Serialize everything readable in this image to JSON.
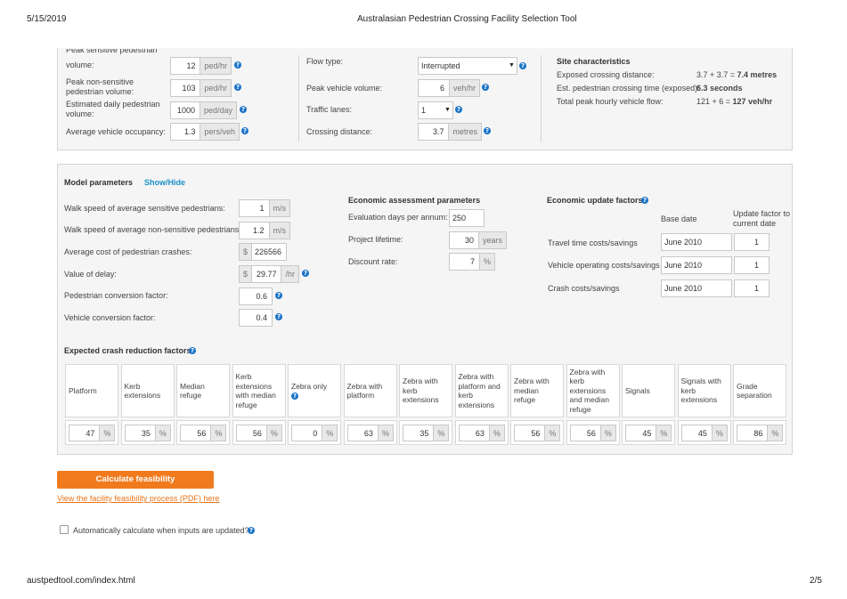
{
  "print": {
    "date": "5/15/2019",
    "title": "Australasian Pedestrian Crossing Facility Selection Tool",
    "url": "austpedtool.com/index.html",
    "page": "2/5"
  },
  "inputs_top": {
    "cut_label": "Peak sensitive pedestrian",
    "rows_left": [
      {
        "label": "volume:",
        "value": "12",
        "unit": "ped/hr"
      },
      {
        "label": "Peak non-sensitive pedestrian volume:",
        "value": "103",
        "unit": "ped/hr"
      },
      {
        "label": "Estimated daily pedestrian volume:",
        "value": "1000",
        "unit": "ped/day"
      },
      {
        "label": "Average vehicle occupancy:",
        "value": "1.3",
        "unit": "pers/veh"
      }
    ],
    "flow_type": {
      "label": "Flow type:",
      "value": "Interrupted"
    },
    "peak_vehicle": {
      "label": "Peak vehicle volume:",
      "value": "6",
      "unit": "veh/hr"
    },
    "traffic_lanes": {
      "label": "Traffic lanes:",
      "value": "1"
    },
    "crossing_distance": {
      "label": "Crossing distance:",
      "value": "3.7",
      "unit": "metres"
    }
  },
  "site": {
    "title": "Site characteristics",
    "rows": [
      {
        "label": "Exposed crossing distance:",
        "calc": "3.7 + 3.7 = ",
        "result": "7.4 metres"
      },
      {
        "label": "Est. pedestrian crossing time (exposed):",
        "calc": "",
        "result": "6.3 seconds"
      },
      {
        "label": "Total peak hourly vehicle flow:",
        "calc": "121 + 6 = ",
        "result": "127 veh/hr"
      }
    ]
  },
  "model": {
    "title": "Model parameters",
    "toggle": "Show/Hide",
    "rows": [
      {
        "label": "Walk speed of average sensitive pedestrians:",
        "value": "1",
        "unit": "m/s",
        "prefix": ""
      },
      {
        "label": "Walk speed of average non-sensitive pedestrians:",
        "value": "1.2",
        "unit": "m/s",
        "prefix": ""
      },
      {
        "label": "Average cost of pedestrian crashes:",
        "value": "226566",
        "unit": "",
        "prefix": "$"
      },
      {
        "label": "Value of delay:",
        "value": "29.77",
        "unit": "/hr",
        "prefix": "$"
      },
      {
        "label": "Pedestrian conversion factor:",
        "value": "0.6",
        "unit": "",
        "prefix": ""
      },
      {
        "label": "Vehicle conversion factor:",
        "value": "0.4",
        "unit": "",
        "prefix": ""
      }
    ]
  },
  "economic": {
    "title": "Economic assessment parameters",
    "rows": [
      {
        "label": "Evaluation days per annum:",
        "value": "250",
        "unit": ""
      },
      {
        "label": "Project lifetime:",
        "value": "30",
        "unit": "years"
      },
      {
        "label": "Discount rate:",
        "value": "7",
        "unit": "%"
      }
    ]
  },
  "update": {
    "title": "Economic update factors",
    "col_base": "Base date",
    "col_factor": "Update factor to current date",
    "rows": [
      {
        "label": "Travel time costs/savings",
        "date": "June  2010",
        "factor": "1"
      },
      {
        "label": "Vehicle operating costs/savings",
        "date": "June  2010",
        "factor": "1"
      },
      {
        "label": "Crash costs/savings",
        "date": "June  2010",
        "factor": "1"
      }
    ]
  },
  "crash": {
    "title": "Expected crash reduction factors",
    "columns": [
      {
        "label": "Platform",
        "value": "47"
      },
      {
        "label": "Kerb extensions",
        "value": "35"
      },
      {
        "label": "Median refuge",
        "value": "56"
      },
      {
        "label": "Kerb extensions with median refuge",
        "value": "56"
      },
      {
        "label": "Zebra only",
        "value": "0"
      },
      {
        "label": "Zebra with platform",
        "value": "63"
      },
      {
        "label": "Zebra with kerb extensions",
        "value": "35"
      },
      {
        "label": "Zebra with platform and kerb extensions",
        "value": "63"
      },
      {
        "label": "Zebra with median refuge",
        "value": "56"
      },
      {
        "label": "Zebra with kerb extensions and median refuge",
        "value": "56"
      },
      {
        "label": "Signals",
        "value": "45"
      },
      {
        "label": "Signals with kerb extensions",
        "value": "45"
      },
      {
        "label": "Grade separation",
        "value": "86"
      }
    ],
    "unit": "%"
  },
  "actions": {
    "calculate": "Calculate feasibility",
    "pdf_link": "View the facility feasibility process (PDF) here",
    "auto_label": "Automatically calculate when inputs are updated?"
  },
  "colors": {
    "accent": "#f07b1f",
    "help": "#1a73c8",
    "link": "#1a90c8"
  }
}
